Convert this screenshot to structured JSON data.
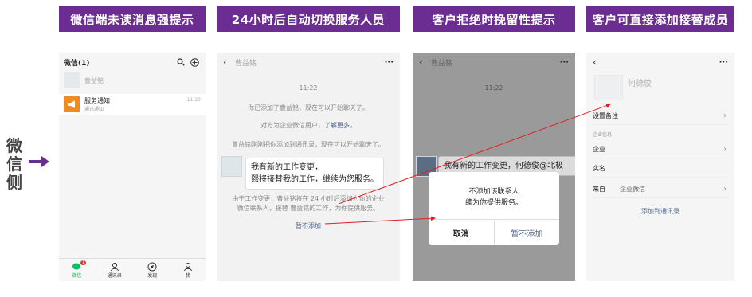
{
  "headers": [
    "微信端未读消息强提示",
    "24小时后自动切换服务人员",
    "客户拒绝时挽留性提示",
    "客户可直接添加接替成员"
  ],
  "side_label": "微信侧",
  "p1": {
    "title": "微信(1)",
    "chat1_name": "曹益铭",
    "chat2_name": "服务通知",
    "chat2_sub": "通讯通知",
    "chat2_time": "11:22",
    "tabs": [
      "微信",
      "通讯录",
      "发现",
      "我"
    ],
    "badge": "1"
  },
  "p2": {
    "contact": "曹益铭",
    "time": "11:22",
    "sys1": "你已添加了曹益铭，现在可以开始聊天了。",
    "sys2_pre": "对方为企业微信用户，",
    "sys2_link": "了解更多。",
    "sys3": "曹益铭刚刚把你添加到通讯录，现在可以开始聊天了。",
    "bubble_line1": "我有新的工作变更，",
    "bubble_line2": "熙将接替我的工作，继续为您服务。",
    "info": "由于工作变更，曹益铭将在 24 小时后添加为你的企业微信联系人，接替 曹益铭的工作，为你提供服务。",
    "reject": "暂不添加"
  },
  "p3": {
    "contact": "曹益铭",
    "time": "11:22",
    "bubble": "我有新的工作变更，何德俊@北极",
    "dialog_line1": "不添加该联系人",
    "dialog_line2": "续为你提供服务。",
    "btn_cancel": "取消",
    "btn_reject": "暂不添加"
  },
  "p4": {
    "name": "何德俊",
    "remark": "设置备注",
    "section": "企业信息",
    "row1": "企业",
    "row2": "实名",
    "row3": "来自",
    "row3_val": "企业微信",
    "add": "添加到通讯录"
  },
  "colors": {
    "header_bg": "#6b2d91",
    "accent": "#576b95",
    "red_line": "#e02020",
    "wechat_green": "#07c160"
  }
}
